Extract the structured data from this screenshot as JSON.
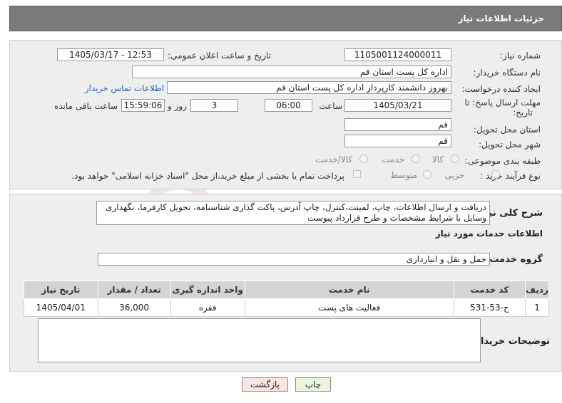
{
  "header": {
    "title": "جزئیات اطلاعات نیاز"
  },
  "form": {
    "need_number_label": "شماره نیاز:",
    "need_number": "1105001124000011",
    "announce_label": "تاریخ و ساعت اعلان عمومی:",
    "announce_value": "1405/03/17 - 12:53",
    "buyer_org_label": "نام دستگاه خریدار:",
    "buyer_org": "اداره کل پست استان قم",
    "creator_label": "ایجاد کننده درخواست:",
    "creator": "بهروز دانشمند کارپرداز اداره کل پست استان قم",
    "contact_link": "اطلاعات تماس خریدار",
    "deadline_label_1": "مهلت ارسال پاسخ: تا",
    "deadline_label_2": "تاریخ:",
    "deadline_date": "1405/03/21",
    "time_label": "ساعت",
    "deadline_time": "06:00",
    "days": "3",
    "days_label": "روز و",
    "remaining_time": "15:59:06",
    "remaining_label": "ساعت باقی مانده",
    "province_label": "استان محل تحویل:",
    "province": "قم",
    "city_label": "شهر محل تحویل:",
    "city": "قم",
    "category_label": "طبقه بندی موضوعی:",
    "category_options": [
      "کالا",
      "خدمت",
      "کالا/خدمت"
    ],
    "purchase_type_label": "نوع فرآیند خرید :",
    "purchase_options": [
      "جزیی",
      "متوسط"
    ],
    "payment_note": "پرداخت تمام یا بخشی از مبلغ خرید،از محل \"اسناد خزانه اسلامی\" خواهد بود."
  },
  "details": {
    "description_label": "شرح کلی نیاز:",
    "description": "دریافت و ارسال اطلاعات، چاپ، لمینت،کنترل، چاپ آدرس، پاکت گذاری شناسنامه، تحویل کارفرما، نگهداری وسایل با شرایط مشخصات و طرح قرارداد پیوست",
    "services_heading": "اطلاعات خدمات مورد نیاز",
    "service_group_label": "گروه خدمت:",
    "service_group": "حمل و نقل و انبارداری",
    "table": {
      "headers": [
        "ردیف",
        "کد خدمت",
        "نام خدمت",
        "واحد اندازه گیری",
        "تعداد / مقدار",
        "تاریخ نیاز"
      ],
      "rows": [
        [
          "1",
          "ح-53-531",
          "فعالیت های پست",
          "فقره",
          "36,000",
          "1405/04/01"
        ]
      ]
    },
    "buyer_notes_label": "توضیحات خریدار:",
    "buyer_notes": ""
  },
  "buttons": {
    "print": "چاپ",
    "back": "بازگشت"
  },
  "watermark": "AriaTender.net"
}
